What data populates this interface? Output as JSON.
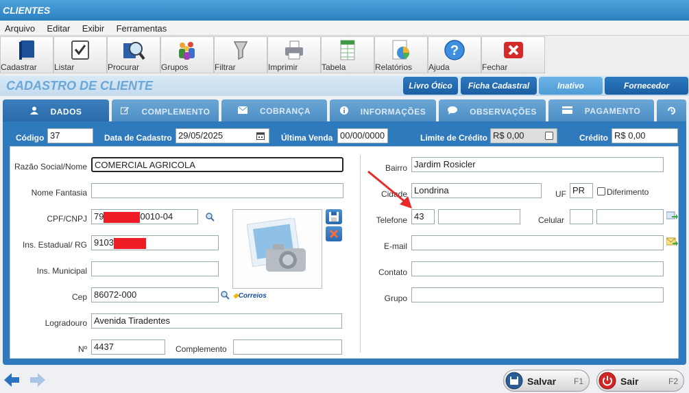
{
  "window": {
    "title": "CLIENTES"
  },
  "menu": [
    "Arquivo",
    "Editar",
    "Exibir",
    "Ferramentas"
  ],
  "toolbar": [
    "Cadastrar",
    "Listar",
    "Procurar",
    "Grupos",
    "Filtrar",
    "Imprimir",
    "Tabela",
    "Relatórios",
    "Ajuda",
    "Fechar"
  ],
  "header": {
    "title": "CADASTRO DE CLIENTE",
    "buttons": [
      "Livro Ótico",
      "Ficha Cadastral",
      "Inativo",
      "Fornecedor"
    ]
  },
  "tabs": [
    "DADOS",
    "COMPLEMENTO",
    "COBRANÇA",
    "INFORMAÇÕES",
    "OBSERVAÇÕES",
    "PAGAMENTO"
  ],
  "top": {
    "codigo_label": "Código",
    "codigo": "37",
    "data_label": "Data de Cadastro",
    "data": "29/05/2025",
    "ultima_label": "Última Venda",
    "ultima": "00/00/0000",
    "limite_label": "Limite de Crédito",
    "limite": "R$ 0,00",
    "credito_label": "Crédito",
    "credito": "R$ 0,00"
  },
  "left": {
    "razao_label": "Razão Social/Nome",
    "razao": "COMERCIAL AGRICOLA",
    "fantasia_label": "Nome Fantasia",
    "fantasia": "",
    "cpf_label": "CPF/CNPJ",
    "cpf_prefix": "79",
    "cpf_suffix": "0010-04",
    "ie_label": "Ins. Estadual/ RG",
    "ie_prefix": "9103",
    "im_label": "Ins. Municipal",
    "im": "",
    "cep_label": "Cep",
    "cep": "86072-000",
    "correios": "Correios",
    "logradouro_label": "Logradouro",
    "logradouro": "Avenida Tiradentes",
    "numero_label": "Nº",
    "numero": "4437",
    "complemento_label": "Complemento",
    "complemento": ""
  },
  "right": {
    "bairro_label": "Bairro",
    "bairro": "Jardim Rosicler",
    "cidade_label": "Cidade",
    "cidade": "Londrina",
    "uf_label": "UF",
    "uf": "PR",
    "diferimento_label": "Diferimento",
    "telefone_label": "Telefone",
    "telefone_ddd": "43",
    "telefone": "",
    "celular_label": "Celular",
    "celular_ddd": "",
    "celular": "",
    "email_label": "E-mail",
    "email": "",
    "contato_label": "Contato",
    "contato": "",
    "grupo_label": "Grupo",
    "grupo": ""
  },
  "footer": {
    "salvar": "Salvar",
    "salvar_key": "F1",
    "sair": "Sair",
    "sair_key": "F2"
  },
  "colors": {
    "accent": "#2f79bd",
    "title": "#6aa6d6",
    "redaction": "#ee1c24"
  }
}
